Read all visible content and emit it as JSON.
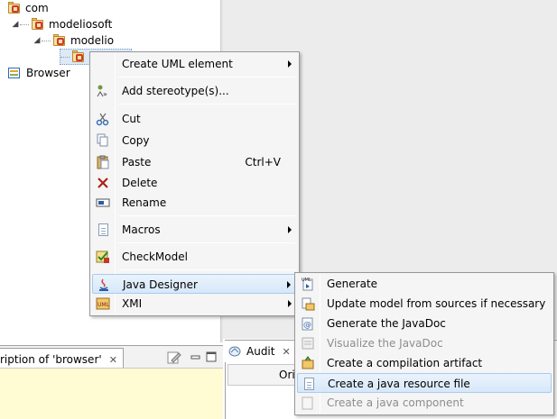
{
  "tree": {
    "items": [
      {
        "label": "com"
      },
      {
        "label": "modeliosoft"
      },
      {
        "label": "modelio"
      },
      {
        "label": "Browser"
      }
    ]
  },
  "context_menu": {
    "items": [
      {
        "label": "Create UML element",
        "icon": "none"
      },
      {
        "label": "Add stereotype(s)...",
        "icon": "stereotype-icon"
      },
      {
        "label": "Cut",
        "icon": "scissors-icon"
      },
      {
        "label": "Copy",
        "icon": "copy-icon"
      },
      {
        "label": "Paste",
        "icon": "paste-icon",
        "accelerator": "Ctrl+V"
      },
      {
        "label": "Delete",
        "icon": "delete-icon"
      },
      {
        "label": "Rename",
        "icon": "rename-icon"
      },
      {
        "label": "Macros",
        "icon": "macro-icon"
      },
      {
        "label": "CheckModel",
        "icon": "check-model-icon"
      },
      {
        "label": "Java Designer",
        "icon": "java-icon"
      },
      {
        "label": "XMI",
        "icon": "xmi-icon"
      }
    ]
  },
  "submenu": {
    "items": [
      {
        "label": "Generate",
        "enabled": true
      },
      {
        "label": "Update model from sources if necessary",
        "enabled": true
      },
      {
        "label": "Generate the JavaDoc",
        "enabled": true
      },
      {
        "label": "Visualize the JavaDoc",
        "enabled": false
      },
      {
        "label": "Create a compilation artifact",
        "enabled": true
      },
      {
        "label": "Create a java resource file",
        "enabled": true
      },
      {
        "label": "Create a java component",
        "enabled": false
      }
    ]
  },
  "description_panel": {
    "title": "ription of 'browser'"
  },
  "audit_panel": {
    "title": "Audit",
    "column_label": "Ori"
  },
  "colors": {
    "highlight_border": "#a9cbee",
    "note_background": "#fffbd2"
  }
}
